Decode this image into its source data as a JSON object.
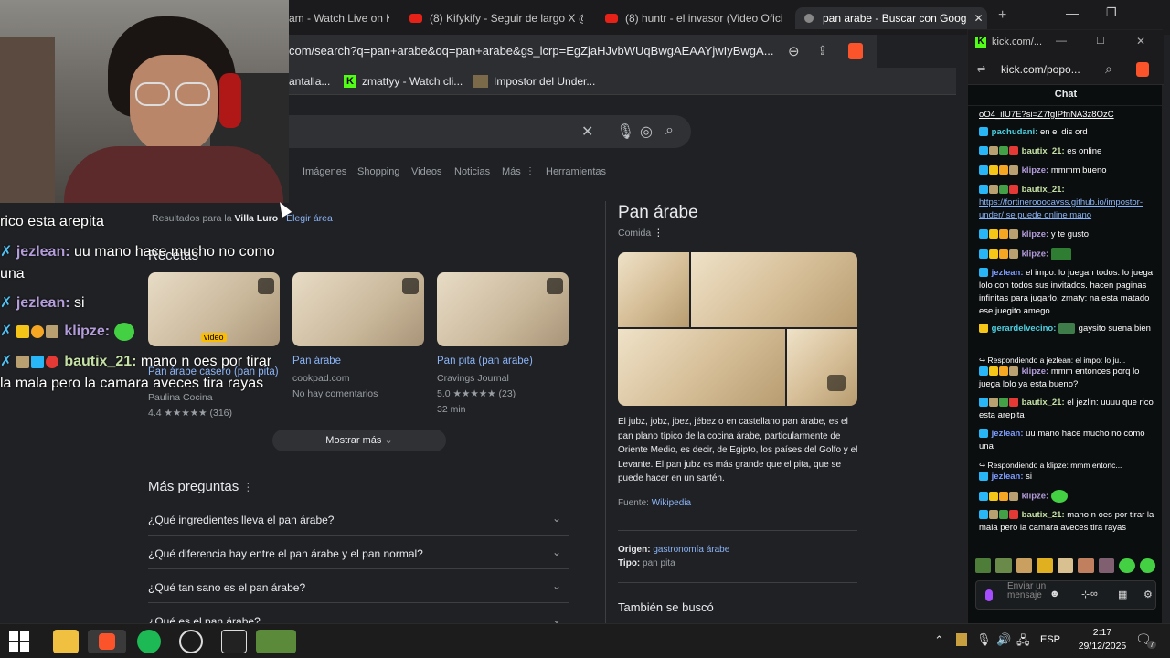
{
  "tabs": [
    {
      "label": "am - Watch Live on K"
    },
    {
      "label": "(8) Kifykify - Seguir de largo X @R"
    },
    {
      "label": "(8) huntr - el invasor (Video Oficia"
    },
    {
      "label": "pan arabe - Buscar con Goog"
    }
  ],
  "address": {
    "url": "com/search?q=pan+arabe&oq=pan+arabe&gs_lcrp=EgZjaHJvbWUqBwgAEAAYjwIyBwgA..."
  },
  "bookmarks": [
    {
      "label": "antalla..."
    },
    {
      "label": "zmattyy - Watch cli..."
    },
    {
      "label": "Impostor del Under..."
    }
  ],
  "search_tabs": [
    "Imágenes",
    "Shopping",
    "Videos",
    "Noticias",
    "Más",
    "Herramientas"
  ],
  "location": {
    "prefix": "Resultados para la",
    "place": "Villa Luro",
    "change": "Elegir área"
  },
  "recipes": {
    "heading": "Recetas",
    "items": [
      {
        "title": "Pan árabe casero (pan pita)",
        "source": "Paulina Cocina",
        "rating": "4.4 ★★★★★ (316)",
        "tag": "video"
      },
      {
        "title": "Pan árabe",
        "source": "cookpad.com",
        "rating": "No hay comentarios"
      },
      {
        "title": "Pan pita (pan árabe)",
        "source": "Cravings Journal",
        "rating": "5.0 ★★★★★ (23)",
        "time": "32 min"
      }
    ],
    "more": "Mostrar más"
  },
  "questions": {
    "heading": "Más preguntas",
    "items": [
      "¿Qué ingredientes lleva el pan árabe?",
      "¿Qué diferencia hay entre el pan árabe y el pan normal?",
      "¿Qué tan sano es el pan árabe?",
      "¿Qué es el pan árabe?"
    ]
  },
  "knowledge": {
    "title": "Pan árabe",
    "subtitle": "Comida",
    "description": "El jubz, jobz, jbez, jébez o en castellano pan árabe, es el pan plano típico de la cocina árabe, particularmente de Oriente Medio, es decir, de Egipto, los países del Golfo y el Levante. El pan jubz es más grande que el pita, que se puede hacer en un sartén.",
    "source_label": "Fuente:",
    "source": "Wikipedia",
    "origin_label": "Origen:",
    "origin": "gastronomía árabe",
    "type_label": "Tipo:",
    "type": "pan pita",
    "also": "También se buscó"
  },
  "overlay": {
    "line0": "rico esta arepita",
    "m1_user": "jezlean:",
    "m1_text": "uu mano hace mucho no como",
    "m1_text2": "una",
    "m2_user": "jezlean:",
    "m2_text": "si",
    "m3_user": "klipze:",
    "m4_user": "bautix_21:",
    "m4_text": "mano n oes por tirar",
    "m4_text2": "la mala pero la camara aveces tira rayas"
  },
  "kick": {
    "window_title": "kick.com/...",
    "address": "kick.com/popo...",
    "chat_label": "Chat",
    "top_link": "oO4_iIU7E?si=Z7fgIPfnNA3z8OzC",
    "messages": [
      {
        "user": "pachudani:",
        "text": "en el dis ord"
      },
      {
        "user": "bautix_21:",
        "text": "es online"
      },
      {
        "user": "klipze:",
        "text": "mmmm bueno"
      },
      {
        "user": "bautix_21:",
        "text": "https://fortinerooocavss.github.io/impostor-under/ se puede online mano"
      },
      {
        "user": "klipze:",
        "text": "y te gusto"
      },
      {
        "user": "klipze:",
        "text": ""
      },
      {
        "user": "jezlean:",
        "text": "el impo: lo juegan todos. lo juega lolo con todos sus invitados. hacen paginas infinitas para jugarlo. zmaty: na esta matado ese juegito amego"
      },
      {
        "user": "gerardelvecino:",
        "text": "gaysito suena bien"
      },
      {
        "reply": "Respondiendo a jezlean: el impo: lo ju..."
      },
      {
        "user": "klipze:",
        "text": "mmm entonces porq lo juega lolo ya esta bueno?"
      },
      {
        "user": "bautix_21:",
        "text": "el jezlin: uuuu que rico esta arepita"
      },
      {
        "user": "jezlean:",
        "text": "uu mano hace mucho no como una"
      },
      {
        "reply": "Respondiendo a klipze: mmm entonc..."
      },
      {
        "user": "jezlean:",
        "text": "si"
      },
      {
        "user": "klipze:",
        "text": ""
      },
      {
        "user": "bautix_21:",
        "text": "mano n oes por tirar la mala pero la camara aveces tira rayas"
      }
    ],
    "input_placeholder": "Enviar un mensaje"
  },
  "taskbar": {
    "lang": "ESP",
    "time": "2:17",
    "date": "29/12/2025",
    "notif": "7"
  }
}
